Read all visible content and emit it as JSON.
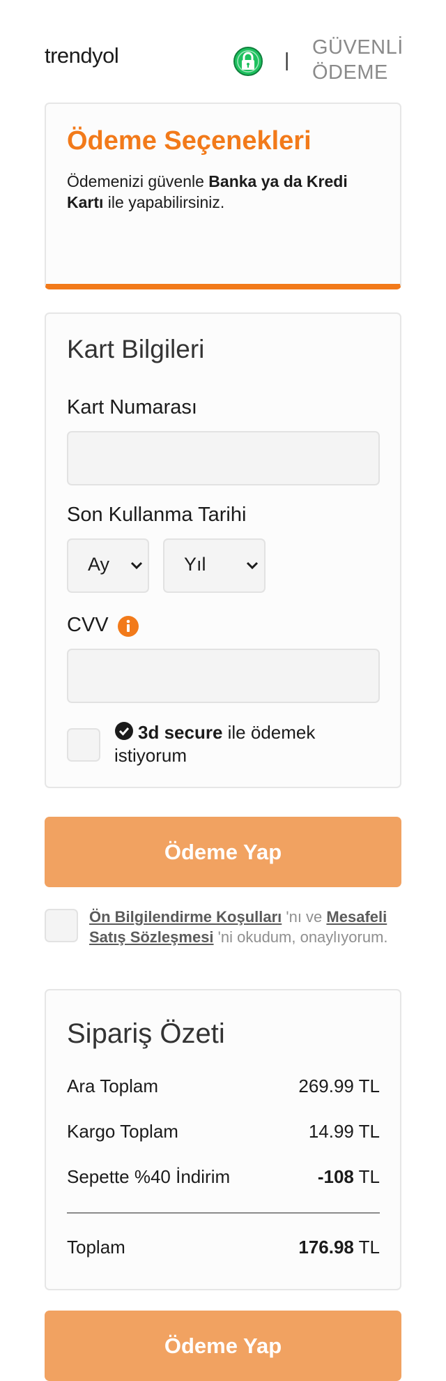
{
  "header": {
    "logo": "trendyol",
    "separator": "|",
    "secure_line1": "GÜVENLİ",
    "secure_line2": "ÖDEME",
    "lock_icon": "lock-icon",
    "lock_color": "#1ec15f"
  },
  "options": {
    "title": "Ödeme Seçenekleri",
    "desc_pre": "Ödemenizi güvenle ",
    "desc_bold": "Banka ya da Kredi Kartı",
    "desc_post": " ile yapabilirsiniz.",
    "accent": "#f27a1a"
  },
  "card_info": {
    "title": "Kart Bilgileri",
    "card_number_label": "Kart Numarası",
    "card_number_value": "",
    "expiry_label": "Son Kullanma Tarihi",
    "month_value": "Ay",
    "year_value": "Yıl",
    "cvv_label": "CVV",
    "cvv_value": "",
    "info_icon": "info-icon",
    "secure_bold": "3d secure",
    "secure_rest": " ile ödemek istiyorum"
  },
  "pay_button": {
    "label": "Ödeme Yap",
    "color": "#f1a261"
  },
  "agreement": {
    "link1": "Ön Bilgilendirme Koşulları",
    "mid": " 'nı ve ",
    "link2": "Mesafeli Satış Sözleşmesi",
    "post": " 'ni okudum, onaylıyorum."
  },
  "summary": {
    "title": "Sipariş Özeti",
    "rows": [
      {
        "label": "Ara Toplam",
        "amount": "269.99",
        "currency": " TL",
        "bold": false
      },
      {
        "label": "Kargo Toplam",
        "amount": "14.99",
        "currency": " TL",
        "bold": false
      },
      {
        "label": "Sepette %40 İndirim",
        "amount": "-108",
        "currency": " TL",
        "bold": true
      },
      {
        "label": "Toplam",
        "amount": "176.98",
        "currency": " TL",
        "bold": true
      }
    ]
  }
}
